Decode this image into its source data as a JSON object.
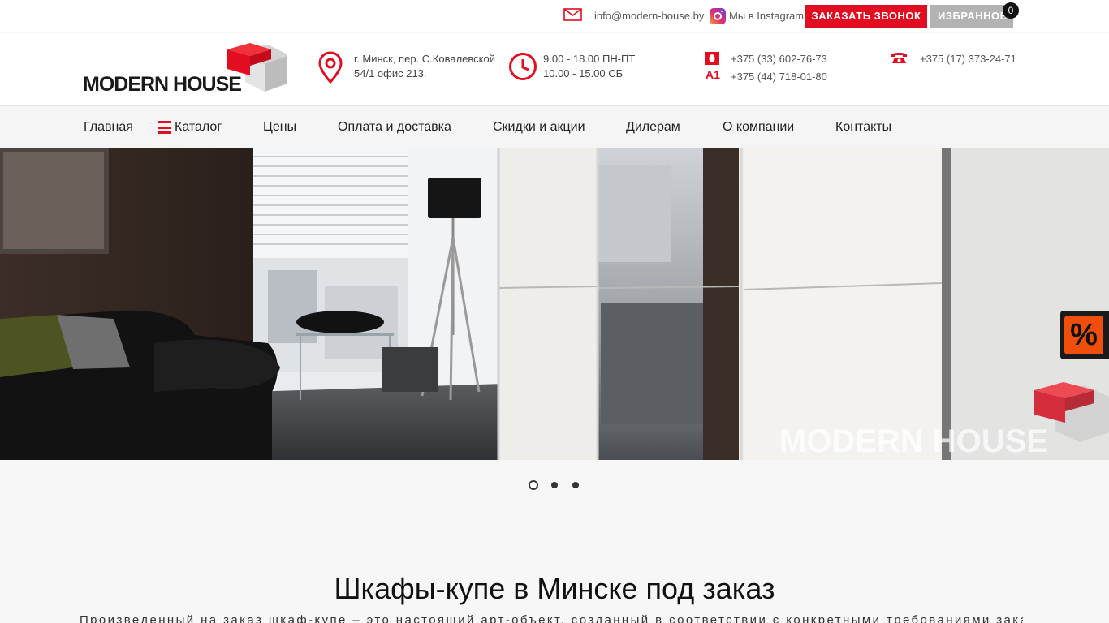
{
  "topbar": {
    "email": "info@modern-house.by",
    "instagram_label": "Мы в Instagram",
    "call_button": "ЗАКАЗАТЬ ЗВОНОК",
    "favorites_button": "ИЗБРАННОЕ",
    "favorites_count": "0"
  },
  "header": {
    "logo_text": "MODERN HOUSE",
    "address_line1": "г. Минск, пер. С.Ковалевской",
    "address_line2": "54/1 офис 213.",
    "hours_line1": "9.00 - 18.00 ПН-ПТ",
    "hours_line2": "10.00 - 15.00 СБ",
    "phone_mts": "+375 (33) 602-76-73",
    "phone_a1": "+375 (44) 718-01-80",
    "a1_label": "A1",
    "phone_city": "+375 (17) 373-24-71"
  },
  "nav": {
    "items": [
      "Главная",
      "Каталог",
      "Цены",
      "Оплата и доставка",
      "Скидки и акции",
      "Дилерам",
      "О компании",
      "Контакты"
    ]
  },
  "hero": {
    "watermark": "MODERN HOUSE",
    "slides_total": 3,
    "active_slide": 1
  },
  "promo_badge": "%",
  "main": {
    "title": "Шкафы-купе в Минске под заказ",
    "intro": "Произведенный на заказ шкаф-купе – это настоящий арт-объект, созданный в соответствии с конкретными требованиями заказчика: стиль"
  },
  "colors": {
    "accent": "#e30d21",
    "favorites_bg": "#b3b3b3",
    "promo": "#f04e0b"
  }
}
